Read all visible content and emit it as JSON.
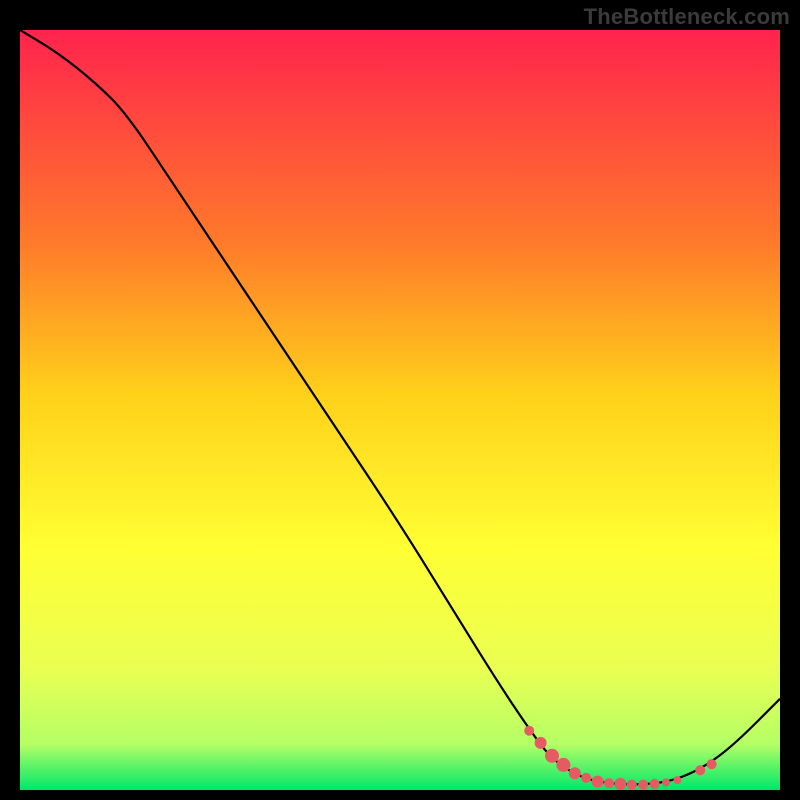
{
  "attribution": "TheBottleneck.com",
  "colors": {
    "gradient_top": "#ff234d",
    "gradient_mid1": "#ff7a2a",
    "gradient_mid2": "#ffd11a",
    "gradient_mid3": "#ffff33",
    "gradient_mid4": "#eaff52",
    "gradient_mid5": "#b4ff66",
    "gradient_bottom": "#00e76a",
    "curve": "#000000",
    "marker": "#e55a63",
    "frame": "#000000"
  },
  "chart_data": {
    "type": "line",
    "title": "",
    "xlabel": "",
    "ylabel": "",
    "xlim": [
      0,
      100
    ],
    "ylim": [
      0,
      100
    ],
    "curve": {
      "name": "bottleneck-curve",
      "points": [
        {
          "x": 0,
          "y": 100
        },
        {
          "x": 5,
          "y": 97
        },
        {
          "x": 10,
          "y": 93
        },
        {
          "x": 14,
          "y": 89
        },
        {
          "x": 20,
          "y": 80
        },
        {
          "x": 30,
          "y": 65
        },
        {
          "x": 40,
          "y": 50
        },
        {
          "x": 50,
          "y": 35
        },
        {
          "x": 58,
          "y": 22
        },
        {
          "x": 63,
          "y": 14
        },
        {
          "x": 67,
          "y": 8
        },
        {
          "x": 70,
          "y": 4
        },
        {
          "x": 74,
          "y": 1.5
        },
        {
          "x": 78,
          "y": 0.8
        },
        {
          "x": 82,
          "y": 0.7
        },
        {
          "x": 86,
          "y": 1.2
        },
        {
          "x": 90,
          "y": 3
        },
        {
          "x": 94,
          "y": 6
        },
        {
          "x": 100,
          "y": 12
        }
      ]
    },
    "markers": [
      {
        "x": 67.0,
        "y": 7.8,
        "r": 5
      },
      {
        "x": 68.5,
        "y": 6.2,
        "r": 6
      },
      {
        "x": 70.0,
        "y": 4.5,
        "r": 7
      },
      {
        "x": 71.5,
        "y": 3.3,
        "r": 7
      },
      {
        "x": 73.0,
        "y": 2.2,
        "r": 6
      },
      {
        "x": 74.5,
        "y": 1.6,
        "r": 5
      },
      {
        "x": 76.0,
        "y": 1.1,
        "r": 6
      },
      {
        "x": 77.5,
        "y": 0.9,
        "r": 5
      },
      {
        "x": 79.0,
        "y": 0.8,
        "r": 6
      },
      {
        "x": 80.5,
        "y": 0.7,
        "r": 5
      },
      {
        "x": 82.0,
        "y": 0.7,
        "r": 5
      },
      {
        "x": 83.5,
        "y": 0.8,
        "r": 5
      },
      {
        "x": 85.0,
        "y": 1.0,
        "r": 4
      },
      {
        "x": 86.5,
        "y": 1.3,
        "r": 4
      },
      {
        "x": 89.5,
        "y": 2.6,
        "r": 5
      },
      {
        "x": 91.0,
        "y": 3.4,
        "r": 5
      }
    ]
  }
}
